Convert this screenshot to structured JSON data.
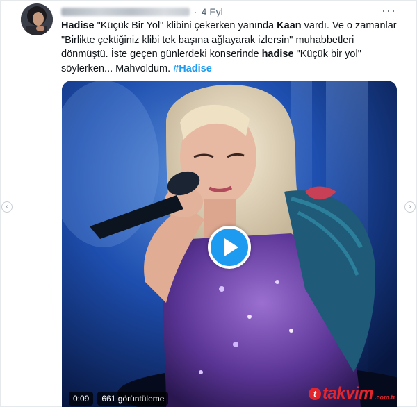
{
  "tweet": {
    "author_name": "",
    "date": "4 Eyl",
    "separator": "·",
    "more_icon": "more-horizontal-icon",
    "text": {
      "p1": "Hadise",
      "p2": " \"Küçük Bir Yol\" klibini çekerken yanında ",
      "p3": "Kaan",
      "p4": " vardı. Ve o zamanlar \"Birlikte çektiğiniz klibi tek başına ağlayarak izlersin\" muhabbetleri dönmüştü. İste geçen günlerdeki konserinde ",
      "p5": "hadise",
      "p6": " \"Küçük bir yol\" söylerken... Mahvoldum. ",
      "p7": "#Hadise"
    }
  },
  "video": {
    "duration": "0:09",
    "views": "661 görüntüleme",
    "play_icon": "play-icon"
  },
  "watermark": {
    "brand": "takvim",
    "tld": ".com.tr",
    "mark": "t"
  },
  "nav": {
    "left_icon": "chevron-left-icon",
    "right_icon": "chevron-right-icon",
    "left_glyph": "‹",
    "right_glyph": "›"
  },
  "colors": {
    "link": "#1d9bf0",
    "play": "#1d9bf0",
    "watermark": "#e3262b"
  }
}
